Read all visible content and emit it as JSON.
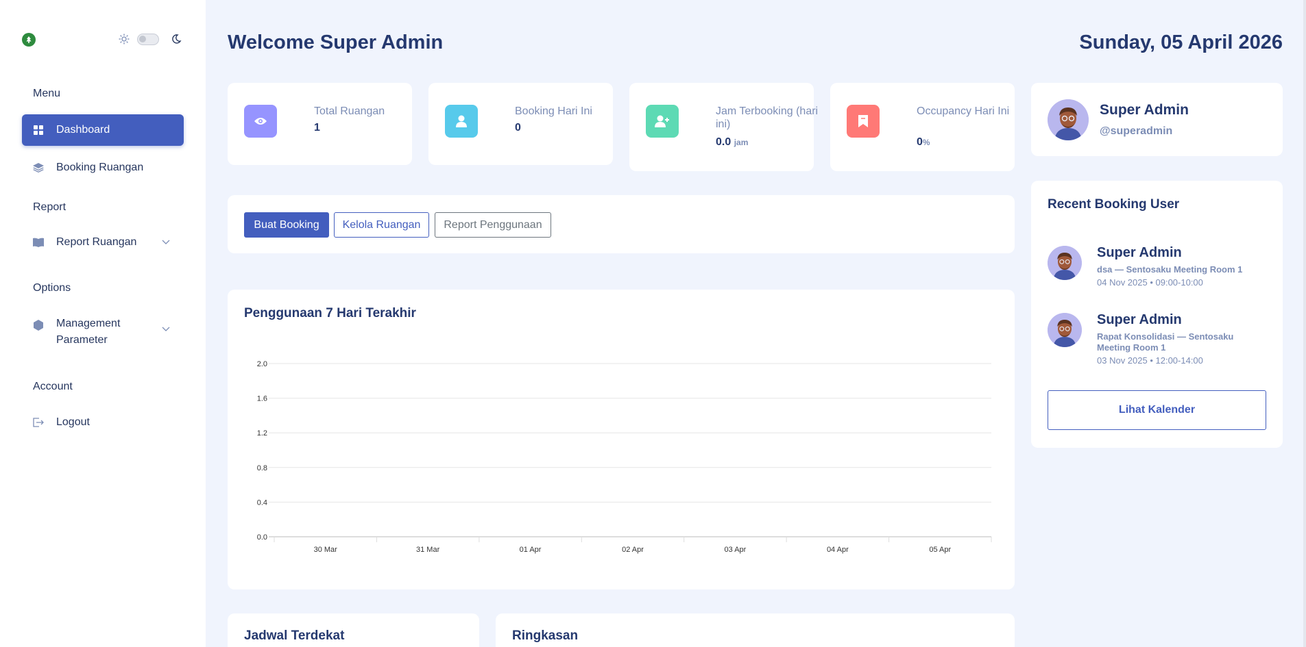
{
  "sidebar": {
    "sections": {
      "menu": "Menu",
      "report": "Report",
      "options": "Options",
      "account": "Account"
    },
    "items": {
      "dashboard": "Dashboard",
      "booking": "Booking Ruangan",
      "report_ruangan": "Report Ruangan",
      "management_1": "Management",
      "management_2": "Parameter",
      "logout": "Logout"
    },
    "active_item": "dashboard"
  },
  "header": {
    "welcome": "Welcome Super Admin",
    "date": "Sunday, 05 April 2026"
  },
  "stats": [
    {
      "label": "Total Ruangan",
      "value": "1",
      "unit": "",
      "color": "#9694ff",
      "icon": "eye-icon"
    },
    {
      "label": "Booking Hari Ini",
      "value": "0",
      "unit": "",
      "color": "#57caeb",
      "icon": "user-icon"
    },
    {
      "label": "Jam Terbooking (hari ini)",
      "value": "0.0",
      "unit": "jam",
      "color": "#5ddab4",
      "icon": "user-plus-icon"
    },
    {
      "label": "Occupancy Hari Ini",
      "value": "0",
      "unit": "%",
      "color": "#ff7976",
      "icon": "bookmark-icon"
    }
  ],
  "profile": {
    "name": "Super Admin",
    "username": "@superadmin"
  },
  "actions": {
    "buat_booking": "Buat Booking",
    "kelola_ruangan": "Kelola Ruangan",
    "report_penggunaan": "Report Penggunaan"
  },
  "usage_chart": {
    "title": "Penggunaan 7 Hari Terakhir"
  },
  "chart_data": {
    "type": "bar",
    "title": "Penggunaan 7 Hari Terakhir",
    "categories": [
      "30 Mar",
      "31 Mar",
      "01 Apr",
      "02 Apr",
      "03 Apr",
      "04 Apr",
      "05 Apr"
    ],
    "values": [
      0,
      0,
      0,
      0,
      0,
      0,
      0
    ],
    "ylim": [
      0,
      2.0
    ],
    "yticks": [
      "2.0",
      "1.6",
      "1.2",
      "0.8",
      "0.4",
      "0.0"
    ],
    "ytick_values": [
      2.0,
      1.6,
      1.2,
      0.8,
      0.4,
      0.0
    ],
    "grid": true,
    "xlabel": "",
    "ylabel": ""
  },
  "recent": {
    "title": "Recent Booking User",
    "items": [
      {
        "name": "Super Admin",
        "desc": "dsa — Sentosaku Meeting Room 1",
        "time": "04 Nov 2025 • 09:00-10:00"
      },
      {
        "name": "Super Admin",
        "desc": "Rapat Konsolidasi — Sentosaku Meeting Room 1",
        "time": "03 Nov 2025 • 12:00-14:00"
      }
    ],
    "calendar_button": "Lihat Kalender"
  },
  "bottom": {
    "jadwal": "Jadwal Terdekat",
    "ringkasan": "Ringkasan"
  },
  "colors": {
    "primary": "#435ebe",
    "heading": "#25396f",
    "muted": "#7c8db5",
    "background": "#f0f4fd"
  }
}
